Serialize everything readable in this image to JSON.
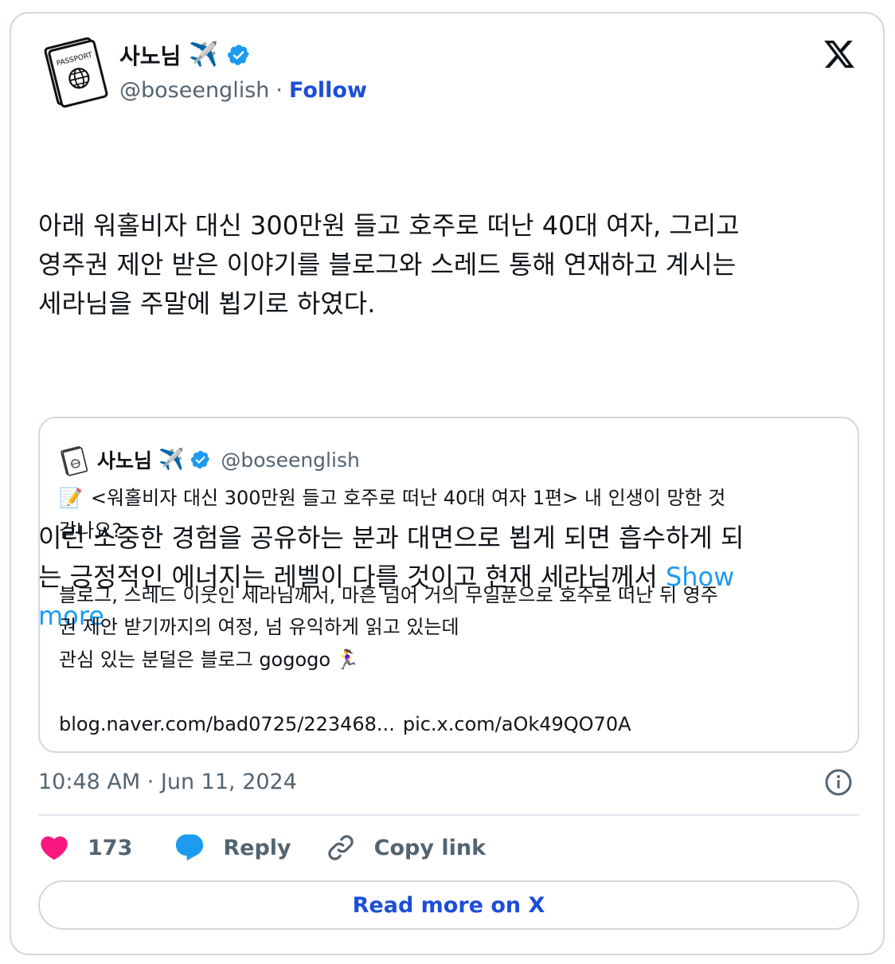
{
  "author": {
    "name": "사노님",
    "name_emoji": "✈️",
    "handle": "@boseenglish",
    "separator": "·",
    "follow_label": "Follow",
    "avatar_text": "PASSPORT"
  },
  "tweet": {
    "paragraphs": [
      "아래 워홀비자 대신 300만원 들고 호주로 떠난 40대 여자, 그리고\n영주권 제안 받은 이야기를 블로그와 스레드 통해 연재하고 계시는\n세라님을 주말에 뵙기로 하였다.",
      "이런 소중한 경험을 공유하는 분과 대면으로 뵙게 되면 흡수하게 되\n는 긍정적인 에너지는 레벨이 다를 것이고 현재 세라님께서 "
    ],
    "show_more_label": "Show\nmore",
    "timestamp": "10:48 AM · Jun 11, 2024"
  },
  "quote": {
    "name": "사노님",
    "name_emoji": "✈️",
    "handle": "@boseenglish",
    "memo_emoji": "📝",
    "line1": "<워홀비자 대신 300만원 들고 호주로 떠난 40대 여자 1편> 내 인생이 망한 것\n같나요?",
    "line2": "블로그, 스레드 이웃인 세라님께서, 마흔 넘어 거의 무일푼으로 호주로 떠난 뒤 영주\n권 제안 받기까지의 여정, 넘 유익하게 읽고 있는데",
    "line3": "관심 있는 분덜은 블로그 gogogo",
    "runner_emoji": "🏃‍♀️",
    "link1": "blog.naver.com/bad0725/223468...",
    "link2": "pic.x.com/aOk49QO70A"
  },
  "actions": {
    "like_count": "173",
    "reply_label": "Reply",
    "copy_label": "Copy link"
  },
  "read_more_label": "Read more on X",
  "icons": {
    "verified": "verified-badge-icon",
    "x_logo": "x-logo-icon",
    "info": "info-icon",
    "heart": "heart-icon",
    "reply": "reply-bubble-icon",
    "link": "link-icon"
  },
  "colors": {
    "accent": "#1d9bf0",
    "follow": "#1d4ed8",
    "heart": "#f91880",
    "muted": "#536471",
    "border": "#cfd9de"
  }
}
